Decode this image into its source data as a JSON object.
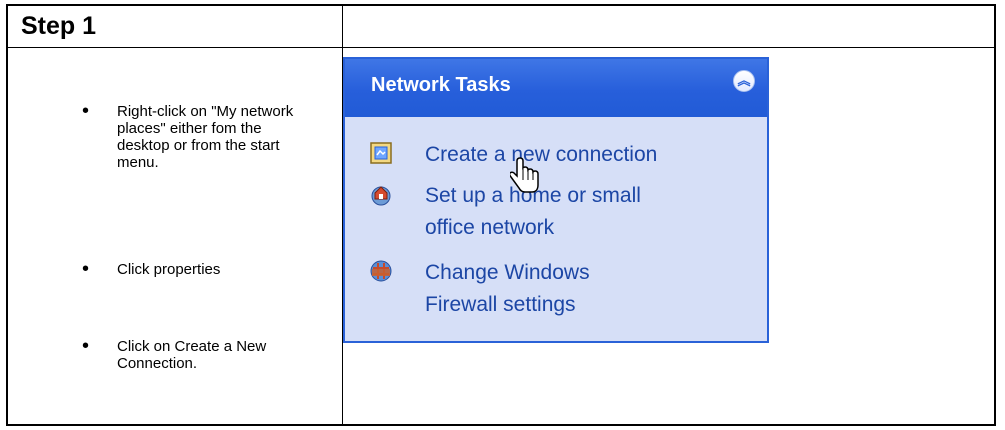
{
  "step": {
    "title": "Step 1"
  },
  "instructions": [
    {
      "text": "Right-click on \"My network places\" either fom the desktop or from the start menu."
    },
    {
      "text": "Click properties"
    },
    {
      "text": "Click on Create a New Connection."
    }
  ],
  "panel": {
    "title": "Network Tasks",
    "collapse_icon": "double-chevron-up-icon",
    "accent": "#2a62d8",
    "tasks": [
      {
        "label": "Create a new connection",
        "icon": "new-connection-icon"
      },
      {
        "label_line1": "Set up a home or small",
        "label_line2": "office network",
        "icon": "home-network-icon"
      },
      {
        "label_line1": "Change Windows",
        "label_line2": "Firewall settings",
        "icon": "firewall-icon"
      }
    ]
  }
}
